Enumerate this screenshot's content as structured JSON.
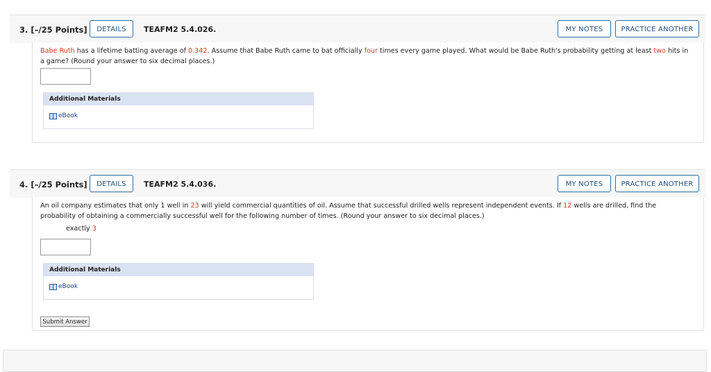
{
  "q3": {
    "number": "3.",
    "points": "[–/25 Points]",
    "details_label": "DETAILS",
    "id": "TEAFM2 5.4.026.",
    "my_notes_label": "MY NOTES",
    "practice_label": "PRACTICE ANOTHER",
    "text": {
      "s1": "Babe Ruth",
      "s2": " has a lifetime batting average of ",
      "s3": "0.342",
      "s4": ". Assume that Babe Ruth came to bat officially ",
      "s5": "four",
      "s6": " times every game played. What would be Babe Ruth's probability getting at least ",
      "s7": "two",
      "s8": " hits in a game? (Round your answer to six decimal places.)"
    },
    "answer_value": "",
    "additional_materials": "Additional Materials",
    "ebook": "eBook"
  },
  "q4": {
    "number": "4.",
    "points": "[–/25 Points]",
    "details_label": "DETAILS",
    "id": "TEAFM2 5.4.036.",
    "my_notes_label": "MY NOTES",
    "practice_label": "PRACTICE ANOTHER",
    "text": {
      "s1": "An oil company estimates that only 1 well in ",
      "s2": "23",
      "s3": " will yield commercial quantities of oil. Assume that successful drilled wells represent independent events. If ",
      "s4": "12",
      "s5": " wells are drilled, find the probability of obtaining a commercially successful well for the following number of times. (Round your answer to six decimal places.)"
    },
    "part_label": "exactly ",
    "part_value": "3",
    "answer_value": "",
    "additional_materials": "Additional Materials",
    "ebook": "eBook",
    "submit_label": "Submit Answer"
  },
  "colors": {
    "highlight": "#d33a1c",
    "button_border": "#2e6ea0",
    "materials_header": "#d9e2f1"
  }
}
